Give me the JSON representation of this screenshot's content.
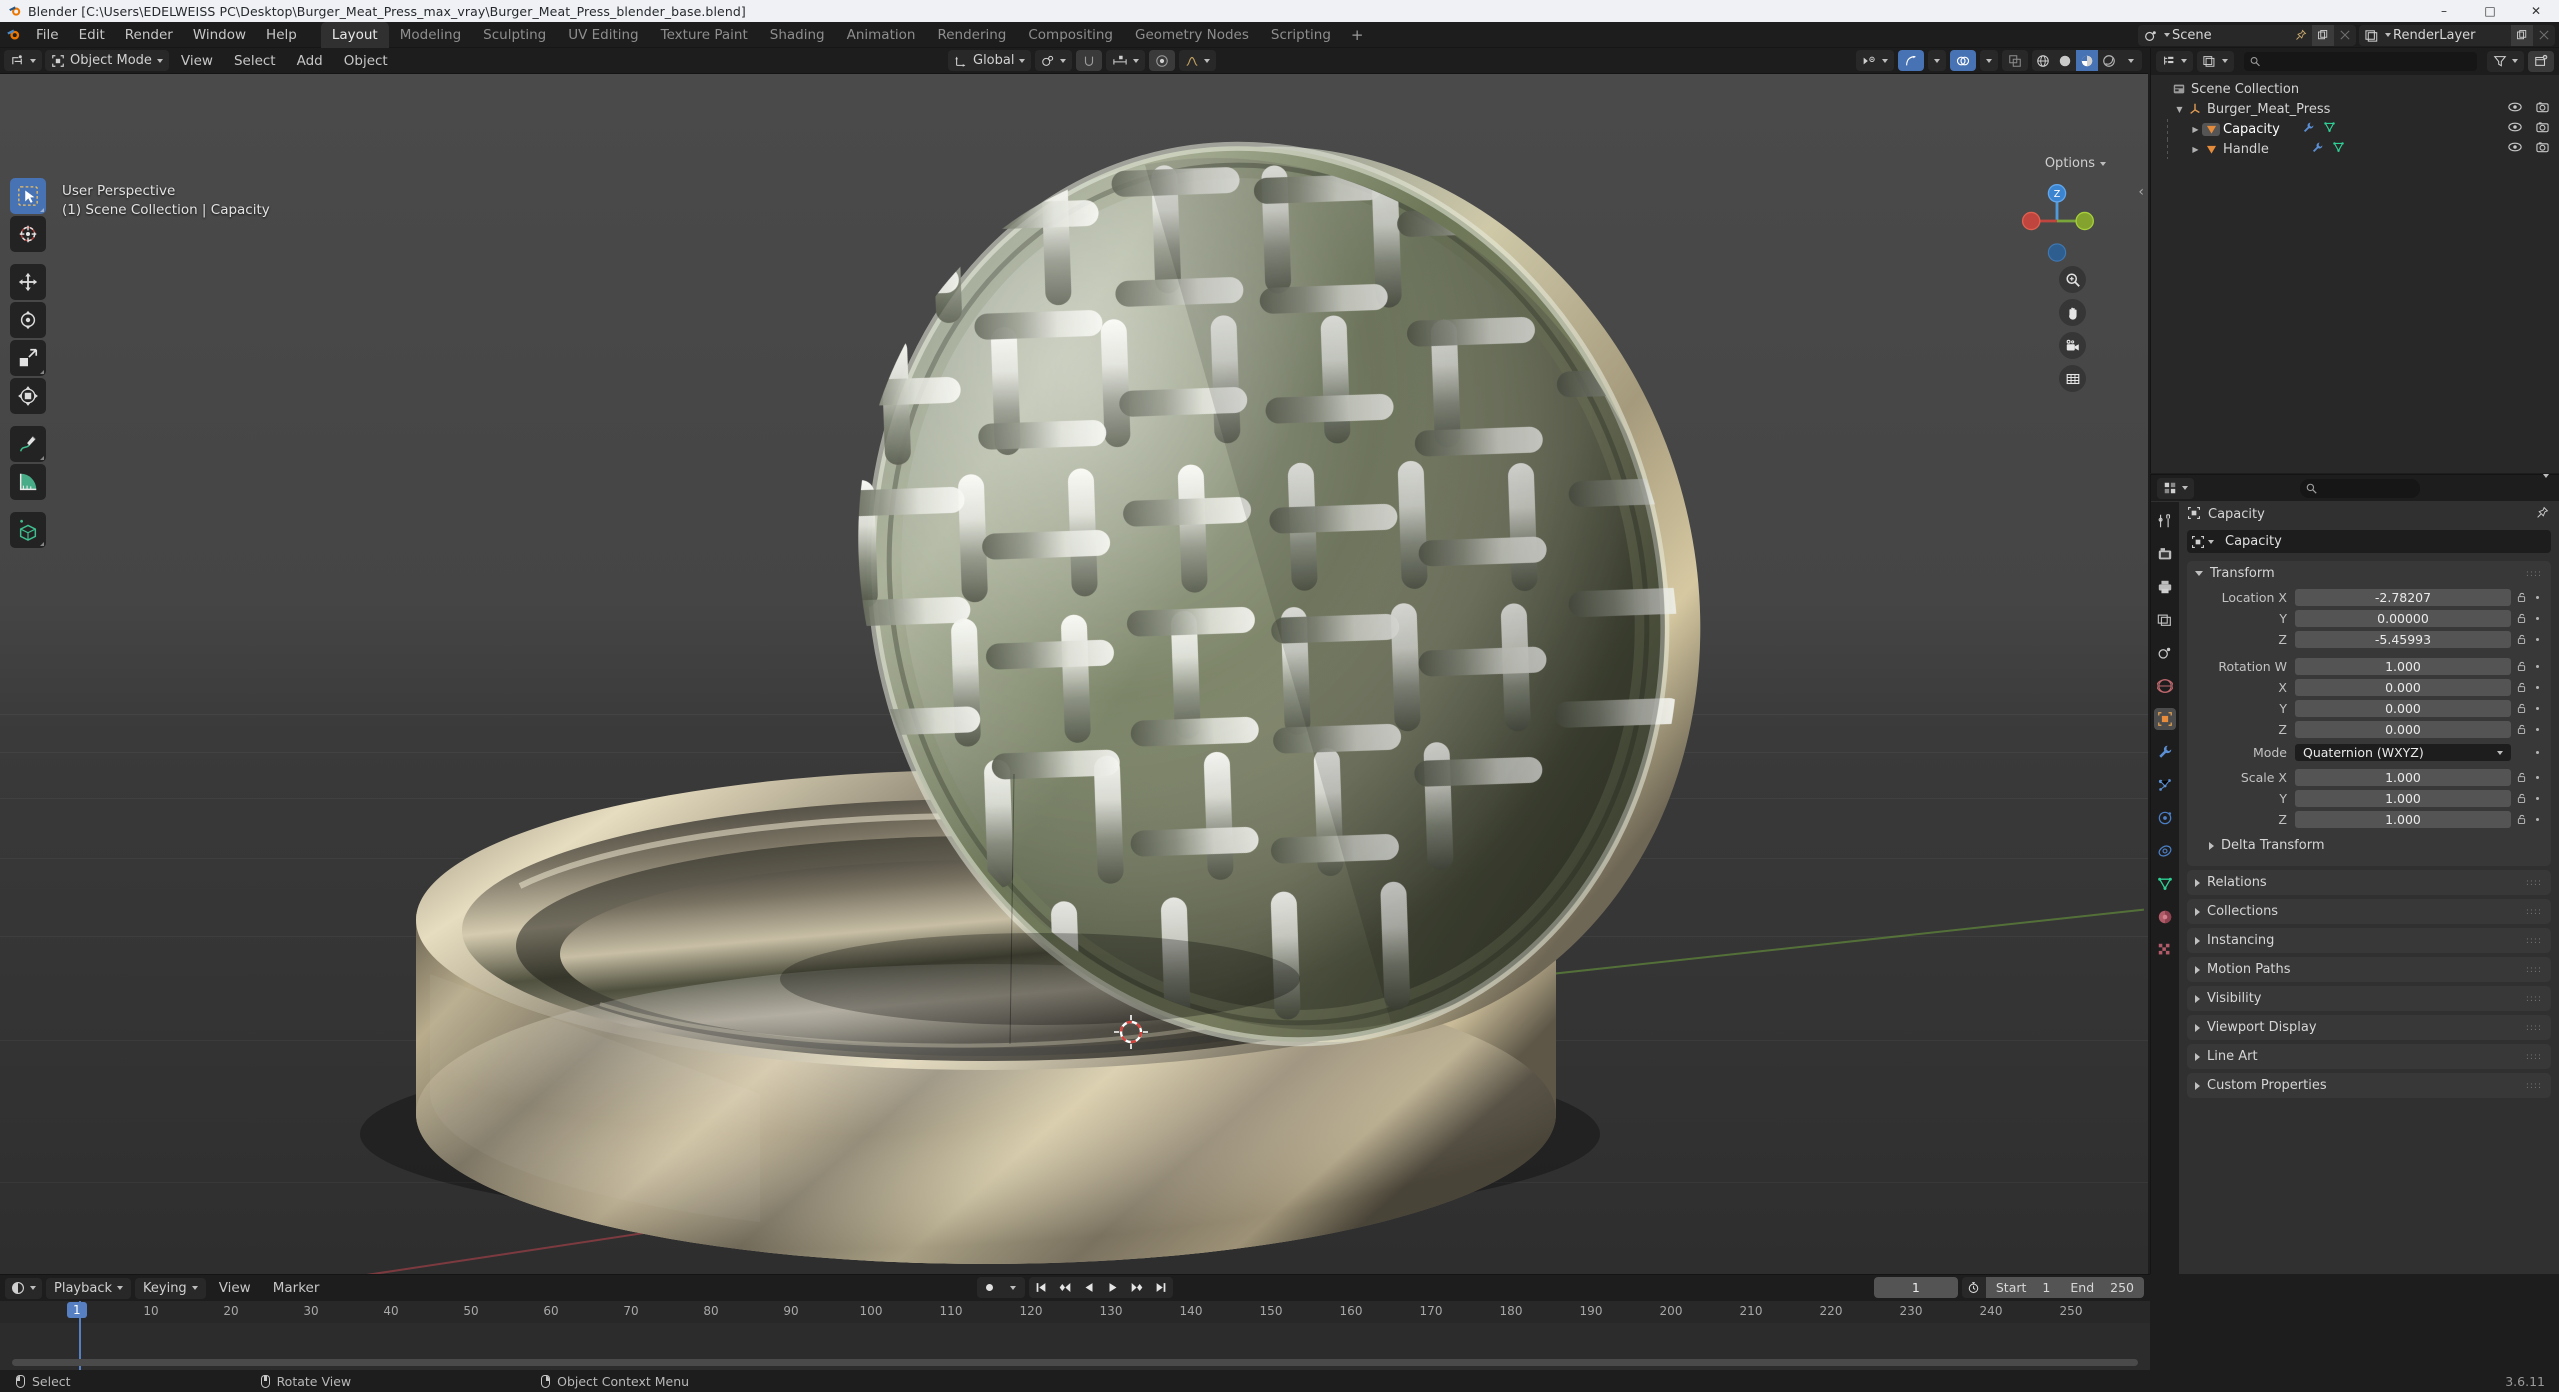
{
  "window": {
    "title": "Blender [C:\\Users\\EDELWEISS PC\\Desktop\\Burger_Meat_Press_max_vray\\Burger_Meat_Press_blender_base.blend]",
    "minimize": "–",
    "maximize": "□",
    "close": "✕"
  },
  "topbar": {
    "menus": [
      "File",
      "Edit",
      "Render",
      "Window",
      "Help"
    ],
    "workspaces": [
      {
        "label": "Layout",
        "active": true
      },
      {
        "label": "Modeling",
        "active": false
      },
      {
        "label": "Sculpting",
        "active": false
      },
      {
        "label": "UV Editing",
        "active": false
      },
      {
        "label": "Texture Paint",
        "active": false
      },
      {
        "label": "Shading",
        "active": false
      },
      {
        "label": "Animation",
        "active": false
      },
      {
        "label": "Rendering",
        "active": false
      },
      {
        "label": "Compositing",
        "active": false
      },
      {
        "label": "Geometry Nodes",
        "active": false
      },
      {
        "label": "Scripting",
        "active": false
      }
    ],
    "add_workspace": "+",
    "scene_name": "Scene",
    "viewlayer_name": "RenderLayer"
  },
  "viewport": {
    "mode": "Object Mode",
    "menus": [
      "View",
      "Select",
      "Add",
      "Object"
    ],
    "transform_orientation": "Global",
    "overlay_line1": "User Perspective",
    "overlay_line2": "(1) Scene Collection | Capacity",
    "options_label": "Options",
    "gizmo_axis_z": "Z",
    "tools": [
      "tweak-select-tool",
      "cursor-tool",
      "move-tool",
      "rotate-tool",
      "scale-tool",
      "transform-tool",
      "annotate-tool",
      "measure-tool",
      "add-cube-tool"
    ],
    "nav_buttons": [
      "zoom-icon",
      "hand-icon",
      "camera-icon",
      "grid-icon"
    ]
  },
  "outliner": {
    "search_placeholder": "",
    "rows": [
      {
        "label": "Scene Collection",
        "level": 0,
        "icon": "collection-icon",
        "expand": "none",
        "eye": false
      },
      {
        "label": "Burger_Meat_Press",
        "level": 1,
        "icon": "empty-axes-icon",
        "expand": "down",
        "eye": true
      },
      {
        "label": "Capacity",
        "level": 2,
        "icon": "mesh-icon",
        "expand": "right",
        "eye": true,
        "selected": true,
        "extra": [
          "modifier-icon",
          "mesh-data-icon"
        ]
      },
      {
        "label": "Handle",
        "level": 2,
        "icon": "mesh-icon",
        "expand": "right",
        "eye": true,
        "selected": false,
        "extra": [
          "modifier-icon",
          "mesh-data-icon"
        ]
      }
    ]
  },
  "properties": {
    "breadcrumb": "Capacity",
    "object_name": "Capacity",
    "transform": {
      "title": "Transform",
      "rows": [
        {
          "label": "Location X",
          "value": "-2.78207"
        },
        {
          "label": "Y",
          "value": "0.00000"
        },
        {
          "label": "Z",
          "value": "-5.45993"
        },
        {
          "gap": true
        },
        {
          "label": "Rotation W",
          "value": "1.000"
        },
        {
          "label": "X",
          "value": "0.000"
        },
        {
          "label": "Y",
          "value": "0.000"
        },
        {
          "label": "Z",
          "value": "0.000"
        },
        {
          "label": "Mode",
          "value": "Quaternion (WXYZ)",
          "dropdown": true
        },
        {
          "label": "Scale X",
          "value": "1.000"
        },
        {
          "label": "Y",
          "value": "1.000"
        },
        {
          "label": "Z",
          "value": "1.000"
        }
      ]
    },
    "delta_transform": "Delta Transform",
    "panels": [
      "Relations",
      "Collections",
      "Instancing",
      "Motion Paths",
      "Visibility",
      "Viewport Display",
      "Line Art",
      "Custom Properties"
    ],
    "tabs": [
      "tool-icon",
      "render-icon",
      "output-icon",
      "viewlayer-icon",
      "scene-icon",
      "world-icon",
      "object-icon",
      "modifier-icon",
      "particles-icon",
      "physics-icon",
      "constraint-icon",
      "data-icon",
      "material-icon",
      "texture-icon"
    ]
  },
  "timeline": {
    "menus": [
      "Playback",
      "Keying",
      "View",
      "Marker"
    ],
    "current_frame": "1",
    "start_label": "Start",
    "start_value": "1",
    "end_label": "End",
    "end_value": "250",
    "ticks": [
      {
        "label": "10",
        "frame": 10
      },
      {
        "label": "20",
        "frame": 20
      },
      {
        "label": "30",
        "frame": 30
      },
      {
        "label": "40",
        "frame": 40
      },
      {
        "label": "50",
        "frame": 50
      },
      {
        "label": "60",
        "frame": 60
      },
      {
        "label": "70",
        "frame": 70
      },
      {
        "label": "80",
        "frame": 80
      },
      {
        "label": "90",
        "frame": 90
      },
      {
        "label": "100",
        "frame": 100
      },
      {
        "label": "110",
        "frame": 110
      },
      {
        "label": "120",
        "frame": 120
      },
      {
        "label": "130",
        "frame": 130
      },
      {
        "label": "140",
        "frame": 140
      },
      {
        "label": "150",
        "frame": 150
      },
      {
        "label": "160",
        "frame": 160
      },
      {
        "label": "170",
        "frame": 170
      },
      {
        "label": "180",
        "frame": 180
      },
      {
        "label": "190",
        "frame": 190
      },
      {
        "label": "200",
        "frame": 200
      },
      {
        "label": "210",
        "frame": 210
      },
      {
        "label": "220",
        "frame": 220
      },
      {
        "label": "230",
        "frame": 230
      },
      {
        "label": "240",
        "frame": 240
      },
      {
        "label": "250",
        "frame": 250
      }
    ],
    "playhead_label": "1"
  },
  "statusbar": {
    "items": [
      {
        "mouse": "left",
        "label": "Select"
      },
      {
        "mouse": "middle",
        "label": "Rotate View"
      },
      {
        "mouse": "right",
        "label": "Object Context Menu"
      }
    ],
    "version": "3.6.11"
  },
  "colors": {
    "accent_blue": "#4772b3",
    "titlebar_bg": "#eff1f5",
    "panel_bg": "#303030",
    "editor_bg": "#1d1d1d",
    "field_bg": "#545454",
    "object_orange": "#ed9e5c",
    "mesh_green": "#2fd095"
  }
}
